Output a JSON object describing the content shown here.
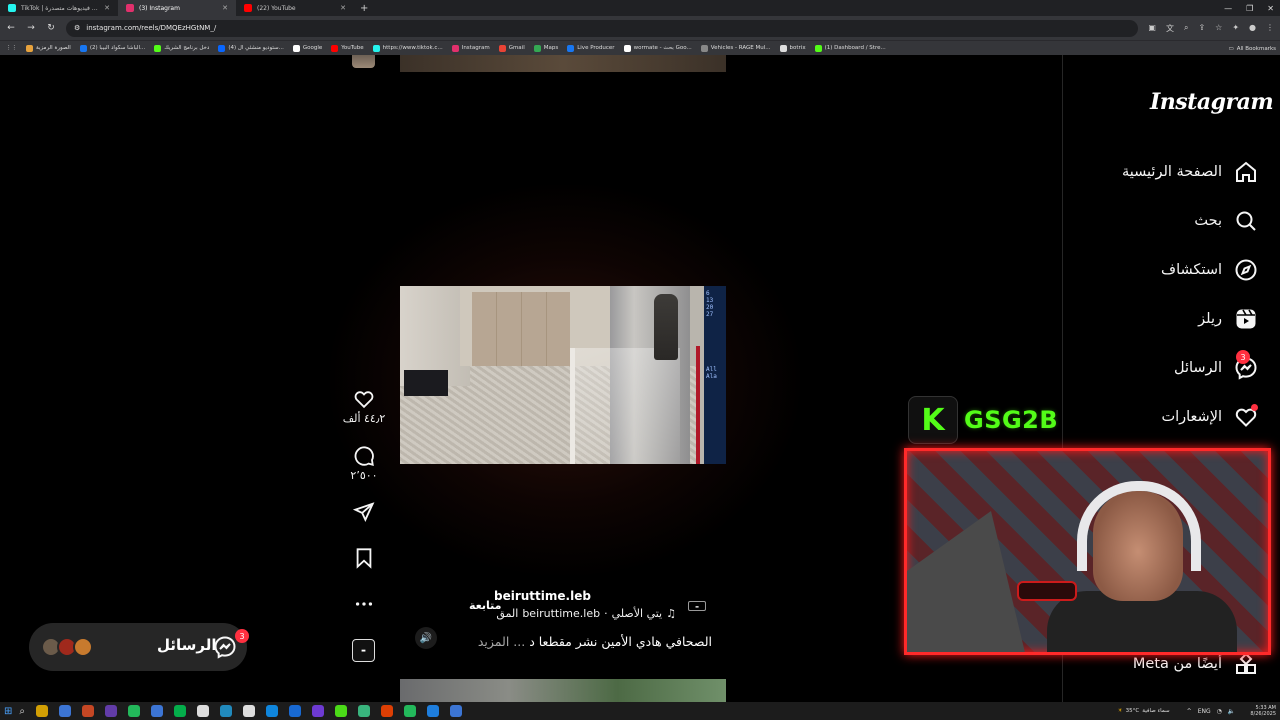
{
  "browser": {
    "tabs": [
      {
        "title": "TikTok | شاهد فيديوهات متصدرة",
        "favicon_color": "#25f4ee",
        "active": false
      },
      {
        "title": "(3) Instagram",
        "favicon_color": "#e1306c",
        "active": true
      },
      {
        "title": "(22) YouTube",
        "favicon_color": "#ff0000",
        "active": false
      }
    ],
    "url": "instagram.com/reels/DMQEzHGtNM_/",
    "bookmarks": [
      {
        "label": "الصورة الرمزية",
        "color": "#e8a33d"
      },
      {
        "label": "(2) الباشا سكواد البيبا...",
        "color": "#1877f2"
      },
      {
        "label": "دخل برنامج الشريك",
        "color": "#53fc18"
      },
      {
        "label": "(4) ستوديو منشئي ال...",
        "color": "#0866ff"
      },
      {
        "label": "Google",
        "color": "#ffffff"
      },
      {
        "label": "YouTube",
        "color": "#ff0000"
      },
      {
        "label": "https://www.tiktok.c...",
        "color": "#25f4ee"
      },
      {
        "label": "Instagram",
        "color": "#e1306c"
      },
      {
        "label": "Gmail",
        "color": "#ea4335"
      },
      {
        "label": "Maps",
        "color": "#34a853"
      },
      {
        "label": "Live Producer",
        "color": "#1877f2"
      },
      {
        "label": "wormate - بحث Goo...",
        "color": "#ffffff"
      },
      {
        "label": "Vehicles - RAGE Mul...",
        "color": "#888888"
      },
      {
        "label": "botrix",
        "color": "#dddddd"
      },
      {
        "label": "(1) Dashboard / Stre...",
        "color": "#53fc18"
      }
    ],
    "all_bookmarks": "All Bookmarks"
  },
  "sidebar": {
    "logo": "Instagram",
    "items": [
      {
        "label": "الصفحة الرئيسية",
        "icon": "home-icon"
      },
      {
        "label": "بحث",
        "icon": "search-icon"
      },
      {
        "label": "استكشاف",
        "icon": "explore-icon"
      },
      {
        "label": "ريلز",
        "icon": "reels-icon"
      },
      {
        "label": "الرسائل",
        "icon": "messenger-icon",
        "badge": "3"
      },
      {
        "label": "الإشعارات",
        "icon": "heart-icon",
        "dot": true
      }
    ],
    "also_from_meta": "أيضًا من Meta"
  },
  "reel": {
    "likes": "٤٤٫٢ ألف",
    "comments": "٢٬٥٠٠",
    "author": "beiruttime.leb",
    "follow": "متابعة",
    "audio_author": "beiruttime.leb",
    "audio_title": "يتي الأصلي",
    "audio_prefix": "المق",
    "caption": "الصحافي هادي الأمين نشر مقطعا د",
    "more": "... المزيد",
    "panel_lines": [
      "6",
      "13",
      "20",
      "27"
    ],
    "panel_lines2": [
      "All",
      "Ala"
    ]
  },
  "messages_pill": {
    "label": "الرسائل",
    "badge": "3",
    "avatar_colors": [
      "#6b5b4a",
      "#a0291c",
      "#c77a2e"
    ]
  },
  "stream": {
    "logo_letter": "K",
    "name": "GSG2B",
    "accent": "#53fc18"
  },
  "taskbar": {
    "weather": "35°C",
    "weather_text": "سماء صافية",
    "lang": "ENG",
    "time": "5:33 AM",
    "date": "8/26/2025",
    "icon_colors": [
      "#f2b600",
      "#4285f4",
      "#e34f26",
      "#6f42c1",
      "#25d366",
      "#4285f4",
      "#00c853",
      "#ffffff",
      "#229ed9",
      "#ffffff",
      "#0d99ff",
      "#1877f2",
      "#7b3ff2",
      "#53fc18",
      "#3ecf8e",
      "#ff4500",
      "#25d366",
      "#1f8fff",
      "#4285f4"
    ]
  }
}
